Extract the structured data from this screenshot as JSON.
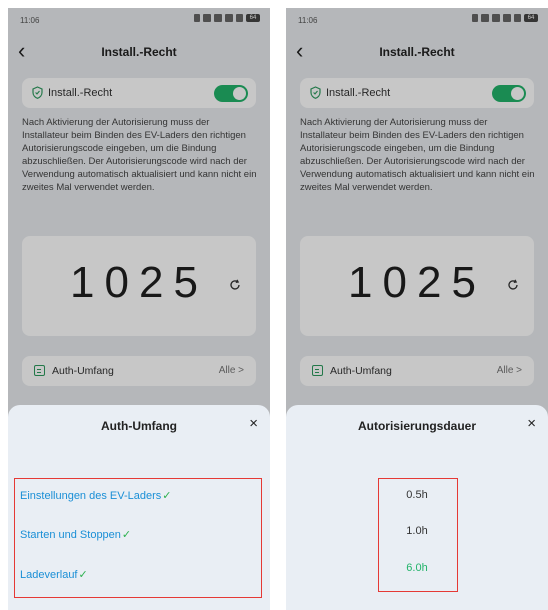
{
  "statusbar": {
    "time": "11:06",
    "battery": "64"
  },
  "screen": {
    "title": "Install.-Recht",
    "toggle_label": "Install.-Recht",
    "toggle_on": true,
    "description": "Nach Aktivierung der Autorisierung muss der Installateur beim Binden des EV-Laders den richtigen Autorisierungscode eingeben, um die Bindung abzuschließen. Der Autorisierungscode wird nach der Verwendung automatisch aktualisiert und kann nicht ein zweites Mal verwendet werden.",
    "code": "1025",
    "auth_label": "Auth-Umfang",
    "auth_value": "Alle >"
  },
  "left_sheet": {
    "title": "Auth-Umfang",
    "close": "×",
    "options": [
      "Einstellungen des EV-Laders",
      "Starten und Stoppen",
      "Ladeverlauf"
    ],
    "check": "✓"
  },
  "right_sheet": {
    "title": "Autorisierungsdauer",
    "close": "×",
    "options": [
      "0.5h",
      "1.0h",
      "6.0h"
    ],
    "selected_index": 2
  },
  "colors": {
    "accent_green": "#22b36a",
    "link_blue": "#1a8fd6",
    "highlight_red": "#e53935"
  }
}
